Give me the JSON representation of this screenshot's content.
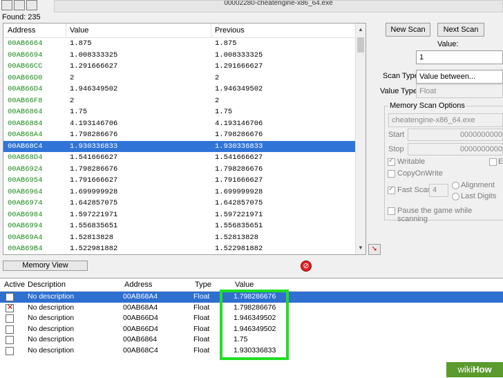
{
  "toolbar": {
    "title": "00002280-cheatengine-x86_64.exe"
  },
  "found": "Found: 235",
  "results": {
    "headers": {
      "address": "Address",
      "value": "Value",
      "previous": "Previous"
    },
    "rows": [
      {
        "address": "00AB6664",
        "value": "1.875",
        "previous": "1.875"
      },
      {
        "address": "00AB6694",
        "value": "1.008333325",
        "previous": "1.008333325"
      },
      {
        "address": "00AB66CC",
        "value": "1.291666627",
        "previous": "1.291666627"
      },
      {
        "address": "00AB66D0",
        "value": "2",
        "previous": "2"
      },
      {
        "address": "00AB66D4",
        "value": "1.946349502",
        "previous": "1.946349502"
      },
      {
        "address": "00AB66F8",
        "value": "2",
        "previous": "2"
      },
      {
        "address": "00AB6864",
        "value": "1.75",
        "previous": "1.75"
      },
      {
        "address": "00AB6884",
        "value": "4.193146706",
        "previous": "4.193146706"
      },
      {
        "address": "00AB68A4",
        "value": "1.798286676",
        "previous": "1.798286676"
      },
      {
        "address": "00AB68C4",
        "value": "1.930336833",
        "previous": "1.930336833"
      },
      {
        "address": "00AB68D4",
        "value": "1.541666627",
        "previous": "1.541666627"
      },
      {
        "address": "00AB6924",
        "value": "1.798286676",
        "previous": "1.798286676"
      },
      {
        "address": "00AB6954",
        "value": "1.791666627",
        "previous": "1.791666627"
      },
      {
        "address": "00AB6964",
        "value": "1.699999928",
        "previous": "1.699999928"
      },
      {
        "address": "00AB6974",
        "value": "1.642857075",
        "previous": "1.642857075"
      },
      {
        "address": "00AB6984",
        "value": "1.597221971",
        "previous": "1.597221971"
      },
      {
        "address": "00AB6994",
        "value": "1.556835651",
        "previous": "1.556835651"
      },
      {
        "address": "00AB69A4",
        "value": "1.52813828",
        "previous": "1.52813828"
      },
      {
        "address": "00AB69B4",
        "value": "1.522981882",
        "previous": "1.522981882"
      }
    ]
  },
  "buttons": {
    "new_scan": "New Scan",
    "next_scan": "Next Scan",
    "memory_view": "Memory View"
  },
  "scan": {
    "value_label": "Value:",
    "value": "1",
    "scan_type_label": "Scan Type",
    "scan_type": "Value between...",
    "value_type_label": "Value Type",
    "value_type": "Float"
  },
  "options": {
    "title": "Memory Scan Options",
    "process": "cheatengine-x86_64.exe",
    "start_label": "Start",
    "start_value": "0000000000",
    "stop_label": "Stop",
    "stop_value": "0000000000",
    "writable": "Writable",
    "executable": "Ex",
    "copy_on_write": "CopyOnWrite",
    "fast_scan": "Fast Scan",
    "fast_scan_value": "4",
    "alignment": "Alignment",
    "last_digits": "Last Digits",
    "pause": "Pause the game while scanning"
  },
  "table": {
    "headers": {
      "active": "Active",
      "description": "Description",
      "address": "Address",
      "type": "Type",
      "value": "Value"
    },
    "rows": [
      {
        "description": "No description",
        "address": "00AB68A4",
        "type": "Float",
        "value": "1.798286676"
      },
      {
        "description": "No description",
        "address": "00AB68A4",
        "type": "Float",
        "value": "1.798286676"
      },
      {
        "description": "No description",
        "address": "00AB66D4",
        "type": "Float",
        "value": "1.946349502"
      },
      {
        "description": "No description",
        "address": "00AB66D4",
        "type": "Float",
        "value": "1.946349502"
      },
      {
        "description": "No description",
        "address": "00AB6864",
        "type": "Float",
        "value": "1.75"
      },
      {
        "description": "No description",
        "address": "00AB68C4",
        "type": "Float",
        "value": "1.930336833"
      }
    ]
  },
  "watermark": {
    "prefix": "wiki",
    "suffix": "How"
  },
  "colors": {
    "selection": "#3174d8",
    "address_green": "#1a8a1a",
    "highlight": "#22dd22"
  }
}
